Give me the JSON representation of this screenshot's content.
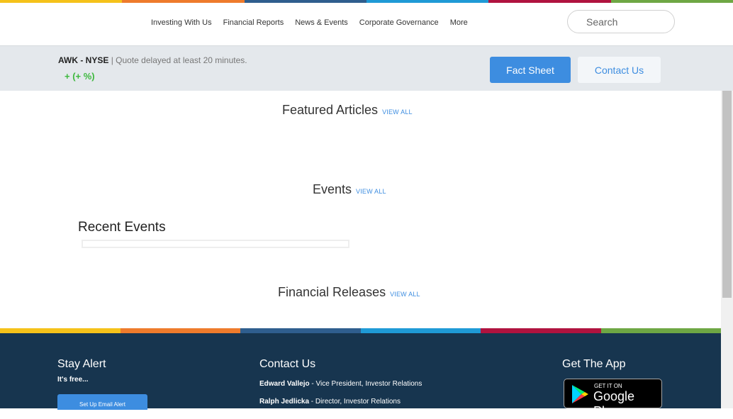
{
  "colors": {
    "stripe": [
      "#f5c21a",
      "#ee7b2c",
      "#2f5e8e",
      "#1f9ad6",
      "#b0133f",
      "#6ea744"
    ],
    "accent": "#3d8de0",
    "footer_bg": "#17354f",
    "positive": "#3db83d"
  },
  "nav": {
    "items": [
      "Investing With Us",
      "Financial Reports",
      "News & Events",
      "Corporate Governance",
      "More"
    ],
    "search_placeholder": "Search"
  },
  "quote": {
    "ticker": "AWK - NYSE",
    "separator": "|",
    "delay_note": "Quote delayed at least 20 minutes.",
    "change": "+ (+ %)",
    "fact_sheet_label": "Fact Sheet",
    "contact_label": "Contact Us"
  },
  "sections": {
    "featured_title": "Featured Articles",
    "events_title": "Events",
    "recent_events_title": "Recent Events",
    "financial_releases_title": "Financial Releases",
    "view_all": "VIEW ALL"
  },
  "footer": {
    "stay_alert_title": "Stay Alert",
    "stay_alert_sub": "It's free...",
    "email_button": "Set Up Email Alert",
    "contact_title": "Contact Us",
    "contacts": [
      {
        "name": "Edward Vallejo",
        "role": " - Vice President, Investor Relations"
      },
      {
        "name": "Ralph Jedlicka",
        "role": " - Director, Investor Relations"
      }
    ],
    "app_title": "Get The App",
    "app_badge_small": "GET IT ON",
    "app_badge_big": "Google Play",
    "app_icon": "google-play-icon"
  }
}
